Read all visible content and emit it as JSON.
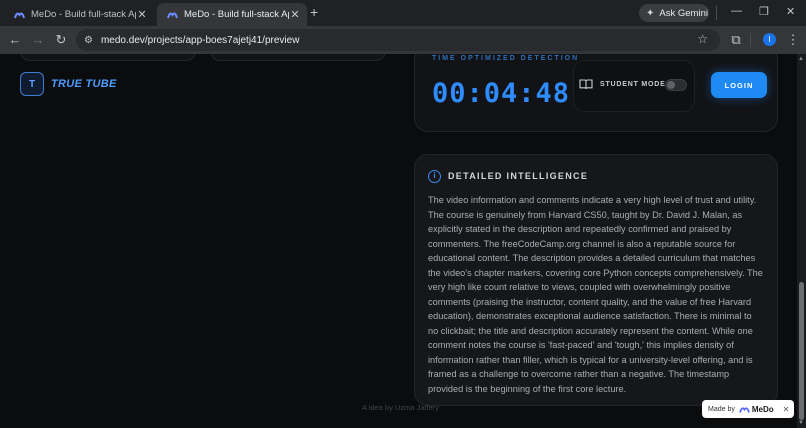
{
  "browser": {
    "tabs": [
      {
        "title": "MeDo - Build full-stack Apps Wi",
        "active": false
      },
      {
        "title": "MeDo - Build full-stack Apps W",
        "active": true
      }
    ],
    "gemini_label": "Ask Gemini",
    "url": "medo.dev/projects/app-boes7ajetj41/preview",
    "profile_initial": "I"
  },
  "app": {
    "logo_letter": "T",
    "logo_text": "TRUE TUBE",
    "time_label": "TIME OPTIMIZED DETECTION",
    "time_value": "00:04:48",
    "student_mode_label": "STUDENT MODE",
    "student_mode_on": false,
    "login_label": "LOGIN",
    "accent_color": "#1f8af4"
  },
  "intelligence": {
    "title": "DETAILED INTELLIGENCE",
    "body": "The video information and comments indicate a very high level of trust and utility. The course is genuinely from Harvard CS50, taught by Dr. David J. Malan, as explicitly stated in the description and repeatedly confirmed and praised by commenters. The freeCodeCamp.org channel is also a reputable source for educational content. The description provides a detailed curriculum that matches the video's chapter markers, covering core Python concepts comprehensively. The very high like count relative to views, coupled with overwhelmingly positive comments (praising the instructor, content quality, and the value of free Harvard education), demonstrates exceptional audience satisfaction. There is minimal to no clickbait; the title and description accurately represent the content. While one comment notes the course is 'fast-paced' and 'tough,' this implies density of information rather than filler, which is typical for a university-level offering, and is framed as a challenge to overcome rather than a negative. The timestamp provided is the beginning of the first core lecture."
  },
  "footer": {
    "credit": "A idea by Uzma Jaffery"
  },
  "badge": {
    "prefix": "Made by",
    "brand": "MeDo",
    "close": "✕"
  }
}
